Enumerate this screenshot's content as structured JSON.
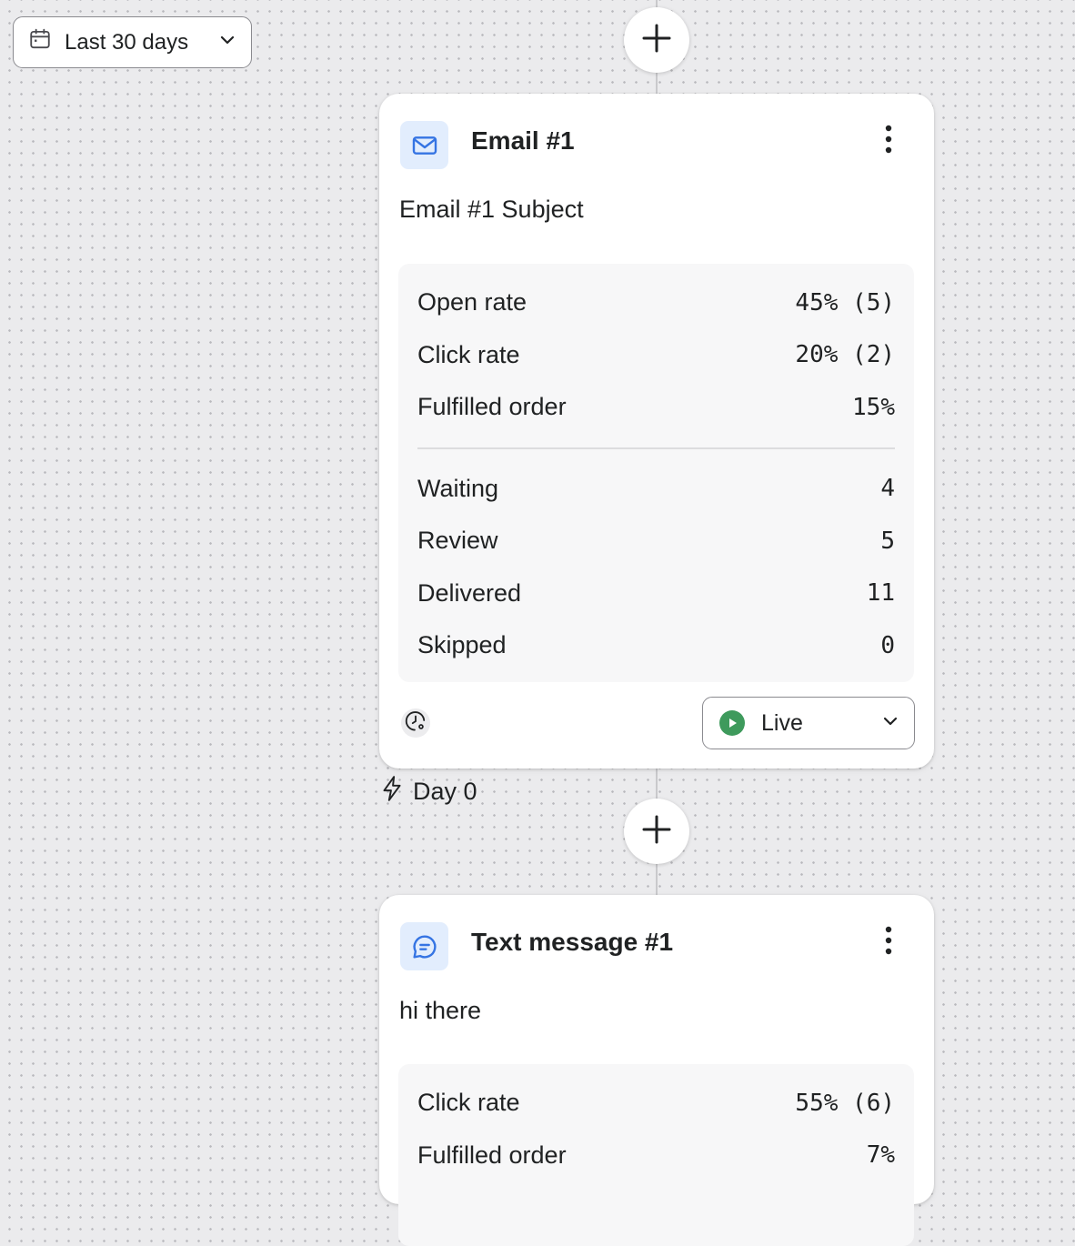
{
  "date_picker": {
    "label": "Last 30 days",
    "icon": "calendar-icon"
  },
  "steps": [
    {
      "type": "email",
      "icon": "email-icon",
      "title": "Email #1",
      "subtitle": "Email #1 Subject",
      "metrics": [
        {
          "label": "Open rate",
          "value": "45% (5)"
        },
        {
          "label": "Click rate",
          "value": "20% (2)"
        },
        {
          "label": "Fulfilled order",
          "value": "15%"
        }
      ],
      "counts": [
        {
          "label": "Waiting",
          "value": "4"
        },
        {
          "label": "Review",
          "value": "5"
        },
        {
          "label": "Delivered",
          "value": "11"
        },
        {
          "label": "Skipped",
          "value": "0"
        }
      ],
      "status": "Live"
    },
    {
      "type": "text-message",
      "icon": "chat-bubble-icon",
      "title": "Text message #1",
      "subtitle": "hi there",
      "metrics": [
        {
          "label": "Click rate",
          "value": "55% (6)"
        },
        {
          "label": "Fulfilled order",
          "value": "7%"
        }
      ]
    }
  ],
  "delay": {
    "label": "Day 0",
    "icon": "lightning-icon"
  },
  "colors": {
    "accent": "#3574e3",
    "icon_bg": "#e2edfd",
    "live_green": "#3e9a5c",
    "canvas": "#ebebed"
  }
}
